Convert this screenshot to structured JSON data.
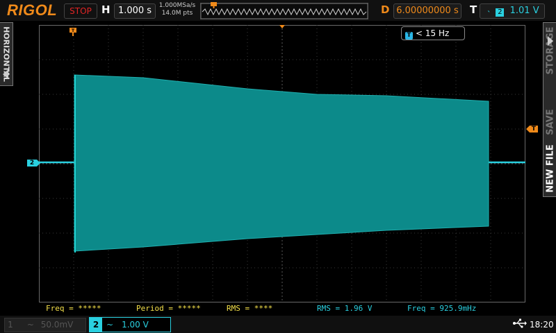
{
  "topbar": {
    "brand": "RIGOL",
    "run_state": "STOP",
    "horizontal_label": "H",
    "timebase": "1.000 s",
    "sample_rate": "1.000MSa/s",
    "memory_depth": "14.0M pts",
    "delay_label": "D",
    "delay": "6.00000000 s",
    "trigger_label": "T",
    "trigger_source": "2",
    "trigger_level": "1.01 V"
  },
  "left_menu": {
    "label": "HORIZONTAL"
  },
  "right_menu": {
    "items": [
      "STORAGE",
      "SAVE",
      "NEW FILE"
    ]
  },
  "trigger_freq": {
    "text": "< 15 Hz"
  },
  "ch2_marker": "2",
  "trig_marker": "T",
  "measurements": [
    {
      "text": "Freq = *****",
      "color": "#f4e04a"
    },
    {
      "text": "Period = *****",
      "color": "#f4e04a"
    },
    {
      "text": "RMS = ****",
      "color": "#f4e04a"
    },
    {
      "text": "RMS = 1.96 V",
      "color": "#2ad0e0"
    },
    {
      "text": "Freq = 925.9mHz",
      "color": "#2ad0e0"
    }
  ],
  "channels": {
    "ch1": {
      "num": "1",
      "coupling_icon": "~",
      "scale": "50.0mV"
    },
    "ch2": {
      "num": "2",
      "coupling_icon": "~",
      "scale": "1.00 V"
    }
  },
  "status": {
    "time": "18:20"
  },
  "colors": {
    "brand": "#f08a1a",
    "ch2": "#2ad0e0",
    "trace_fill": "#0c8a8a",
    "stop": "#e02424",
    "measurement_yellow": "#f4e04a"
  }
}
